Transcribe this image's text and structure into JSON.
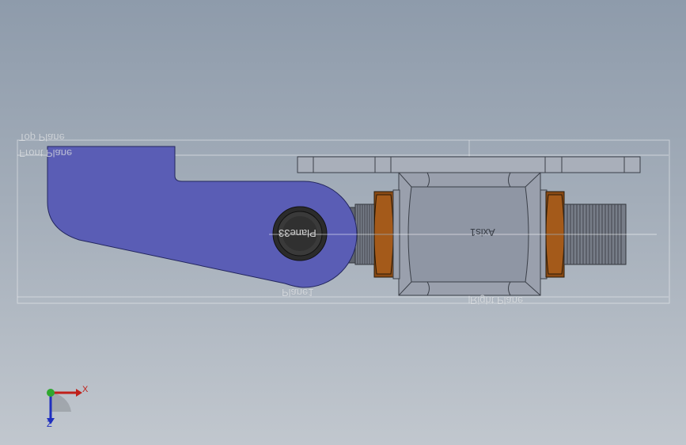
{
  "planes": {
    "top_plane": "Top Plane",
    "front_plane": "Front Plane",
    "right_plane": "Right Plane",
    "plane_label": "Plane1"
  },
  "annotations": {
    "hole_label": "Plane33",
    "axis_label": "Axis1"
  },
  "triad": {
    "x_label": "X",
    "z_label": "Z",
    "x_color": "#c0201a",
    "y_color": "#2fa82f",
    "z_color": "#1f2fbf"
  },
  "colors": {
    "lever": "#5a5db5",
    "body": "#9aa0ad",
    "nut": "#8a4a14",
    "thread": "#6f7580",
    "knob": "#2b2b2b"
  }
}
